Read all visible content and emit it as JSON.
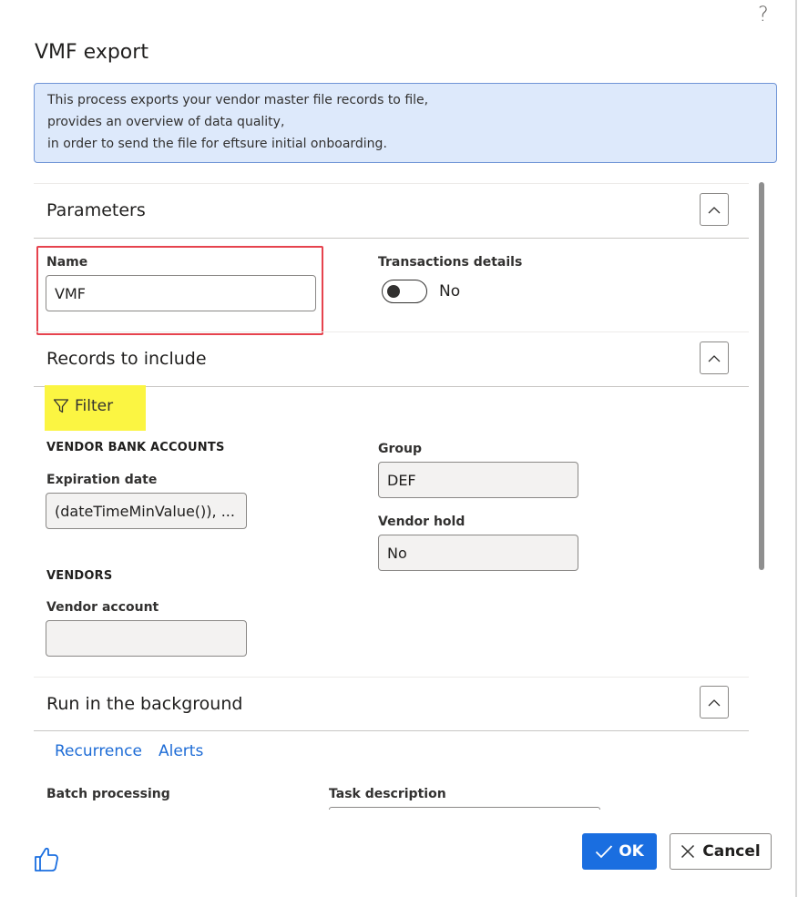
{
  "dialog": {
    "help_glyph": "?",
    "title": "VMF export",
    "info_lines": [
      "This process exports your vendor master file records to file,",
      "provides an overview of data quality,",
      "in order to send the file for eftsure initial onboarding."
    ]
  },
  "parameters": {
    "title": "Parameters",
    "name_label": "Name",
    "name_value": "VMF",
    "transactions_label": "Transactions details",
    "transactions_value": "No"
  },
  "records": {
    "title": "Records to include",
    "filter_label": "Filter",
    "vendor_bank_heading": "VENDOR BANK ACCOUNTS",
    "expiration_label": "Expiration date",
    "expiration_value": "(dateTimeMinValue()), ...",
    "group_label": "Group",
    "group_value": "DEF",
    "vendor_hold_label": "Vendor hold",
    "vendor_hold_value": "No",
    "vendors_heading": "VENDORS",
    "vendor_account_label": "Vendor account",
    "vendor_account_value": ""
  },
  "background": {
    "title": "Run in the background",
    "recurrence_label": "Recurrence",
    "alerts_label": "Alerts",
    "batch_label": "Batch processing",
    "task_label": "Task description"
  },
  "footer": {
    "ok_label": "OK",
    "cancel_label": "Cancel"
  },
  "colors": {
    "accent": "#1a6ee0",
    "info_bg": "#dde9fb",
    "highlight_red": "#e6434e",
    "highlight_yellow": "#fbf542"
  }
}
